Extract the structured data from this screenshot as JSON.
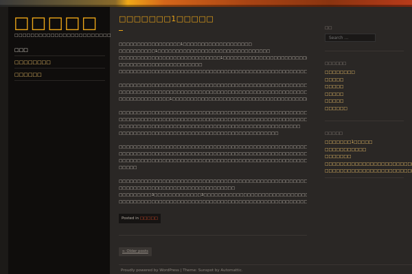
{
  "colors": {
    "accent": "#f0a818",
    "link": "#f0c36a",
    "category_link": "#e8502a",
    "background": "#2a2725",
    "sidebar_bg": "#0f0d0c"
  },
  "site": {
    "title": "□□□□□",
    "description": "□□□□□□□□□□□□□□□□□□□□□□□□"
  },
  "nav": {
    "items": [
      {
        "label": "□□□"
      },
      {
        "label": "□□□□□□□□"
      },
      {
        "label": "□□□□□□"
      }
    ]
  },
  "post": {
    "title": "□□□□□□□1□□□□□",
    "paragraphs": [
      [
        "□□□□□□□□□□□□□□□□□1□□□□□□□□□□□□□□□□□□□",
        "□□□□□□□□□□1□□□□□□□□□□□□□□□□□□□□□□□□□□□□□□□",
        "□□□□□□□□□□□□□□□□□□□□□□□□□□□□1□□□□□□□□□□□□□□□□□□□□□□□□□□□□□□□□□□□□□□□□□□□□□□□",
        "□□□□□□□□□□□□□□□□□□□□□□□",
        "□□□□□□□□□□□□□□□□□□□□□□□□□□□□□□□□□□□□□□□□□□□□□□□□□□□□□□□□□□□□□□□"
      ],
      [
        "□□□□□□□□□□□□□□□□□□□□□□□□□□□□□□□□□□□□□□□□□□□□□□□□□□□□□□□□□□□□□□",
        "□□□□□□□□□□□□□□□□□□□□□□□□□□□□□□□□□□□□□□□□□□□□□□□□□□□□□□□□□□□□□□□□□□□□□□",
        "□□□□□□□□□□□□□□1□□□□□□□□□□□□□□□□□□□□□□□□□□□□□□□□□□□□□□□□□□□"
      ],
      [
        "□□□□□□□□□□□□□□□□□□□□□□□□□□□□□□□□□□□□□□□□□□□□□□□□□□□□□□□□□□□□□□□□□□□□",
        "□□□□□□□□□□□□□□□□□□□□□□□□□□□□□□□□□□□□□□□□□□□□□□□□□□□□□",
        "□□□□□□□□□□□□□□□□□□□□□□□□□□□□□□□□□□□□□□□□□□□□□□□□□□",
        "□□□□□□□□□□□□□□□□□□□□□□□□□□□□□□□□□□□□□□□□□□□□"
      ],
      [
        "□□□□□□□□□□□□□□□□□□□□□□□□□□□□□□□□□□□□□□□□□□□□□□□□□□□□□□□□□□□□□□□□□□□□□□□□□□□□",
        "□□□□□□□□□□□□□□□□□□□□□□□□□□□□□□□□□□□□□□□□□□□□□□□□□□□□□□□□□□□□□□□□□□□□□□□□□□□□",
        "□□□□□□□□□□□□□□□□□□□□□□□□□□□□□□□□□□□□□□□□□□□□□□□□□□□□□□□□□□□□□□□□□□□□□□□□□□□□",
        "□□□□□"
      ],
      [
        "□□□□□□□□□□□□□□□□□□□□□□□□□□□□□□□□□□□□□□□□□□□□□□□□□□□□□□□□□□□□□□□□□□□□□□□□□□□□",
        "□□□□□□□□□□□□□□□□□□□□□□□□□□□□□□□□",
        "□□□□□□□□□3□□□□□□□□□□□□□3□□□□□□□□□□□□□□□□□□□□□□□□□□□□□□□□□□□□□□□□□□□□□□□□□□",
        "□□□□□□□□□□□□□□□□□□□□□□□□□□□□□□□□□□□□□□□□□□□□□□□□□□□□□□□□□□□□□□□□"
      ]
    ],
    "posted_prefix": "Posted in",
    "category": "□□□□□"
  },
  "pagination": {
    "older_label": "← Older posts"
  },
  "footer": {
    "powered": "Proudly powered by WordPress",
    "separator": " | ",
    "theme_prefix": "Theme: Sunspot by ",
    "theme_author": "Automattic",
    "end": "."
  },
  "sidebar": {
    "search": {
      "title": "□□",
      "placeholder": "Search …"
    },
    "recent_title": "□□□□□□",
    "recent_items": [
      {
        "label": "□□□□□□□□"
      },
      {
        "label": "□□□□□"
      },
      {
        "label": "□□□□□"
      },
      {
        "label": "□□□□□"
      },
      {
        "label": "□□□□□"
      },
      {
        "label": "□□□□□□"
      }
    ],
    "category_title": "□□□□□",
    "category_items": [
      {
        "label": "□□□□□□□1□□□□□"
      },
      {
        "label": "□□□□□□□□□□□"
      },
      {
        "label": "□□□□□□□"
      },
      {
        "label": "□□□□□□□□□□□□□□□□□□□□□□□□□□□□"
      },
      {
        "label": "□□□□□□□□□□□□□□□□□□□□□□□□□□"
      }
    ]
  }
}
